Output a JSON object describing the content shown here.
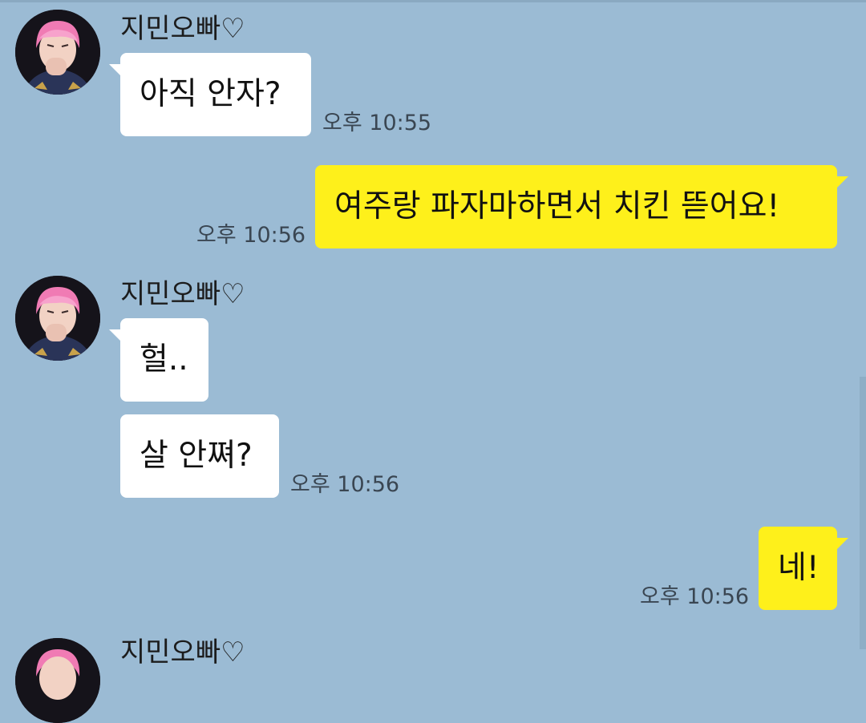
{
  "colors": {
    "background": "#9bbbd4",
    "incoming_bubble": "#ffffff",
    "outgoing_bubble": "#fef01b"
  },
  "contact": {
    "name": "지민오빠♡",
    "avatar_icon": "profile-photo-avatar"
  },
  "messages": [
    {
      "direction": "incoming",
      "sender": "지민오빠♡",
      "text": "아직 안자?",
      "time": "오후 10:55"
    },
    {
      "direction": "outgoing",
      "text": "여주랑 파자마하면서 치킨 뜯어요!",
      "time": "오후 10:56"
    },
    {
      "direction": "incoming",
      "sender": "지민오빠♡",
      "text": "헐..",
      "time": ""
    },
    {
      "direction": "incoming",
      "text": "살 안쪄?",
      "time": "오후 10:56"
    },
    {
      "direction": "outgoing",
      "text": "네!",
      "time": "오후 10:56"
    },
    {
      "direction": "incoming",
      "sender": "지민오빠♡",
      "text": "",
      "time": ""
    }
  ]
}
